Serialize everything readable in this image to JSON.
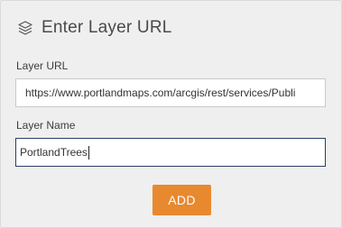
{
  "header": {
    "icon": "layers-icon",
    "title": "Enter Layer URL"
  },
  "layer_url": {
    "label": "Layer URL",
    "value": "https://www.portlandmaps.com/arcgis/rest/services/Publi"
  },
  "layer_name": {
    "label": "Layer Name",
    "value": "PortlandTrees"
  },
  "actions": {
    "add_label": "ADD"
  },
  "colors": {
    "accent": "#e8892f",
    "panel_background": "#efefef",
    "focus_border": "#2c3e66"
  }
}
